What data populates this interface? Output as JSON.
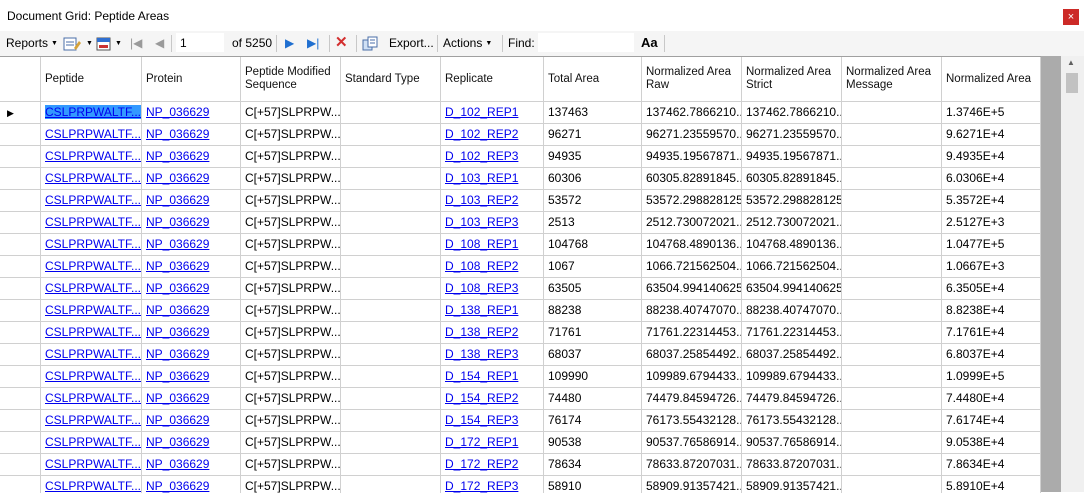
{
  "window": {
    "title": "Document Grid: Peptide Areas",
    "close_icon": "×"
  },
  "toolbar": {
    "reports_label": "Reports",
    "position_value": "1",
    "of_label": "of 5250",
    "export_label": "Export...",
    "actions_label": "Actions",
    "find_label": "Find:",
    "find_value": "",
    "font_icon": "Aa"
  },
  "grid": {
    "headers": [
      "Peptide",
      "Protein",
      "Peptide Modified Sequence",
      "Standard Type",
      "Replicate",
      "Total Area",
      "Normalized Area Raw",
      "Normalized Area Strict",
      "Normalized Area Message",
      "Normalized Area"
    ],
    "rows": [
      [
        "CSLPRPWALTF...",
        "NP_036629",
        "C[+57]SLPRPW...",
        "",
        "D_102_REP1",
        "137463",
        "137462.7866210...",
        "137462.7866210...",
        "",
        "1.3746E+5"
      ],
      [
        "CSLPRPWALTF...",
        "NP_036629",
        "C[+57]SLPRPW...",
        "",
        "D_102_REP2",
        "96271",
        "96271.23559570...",
        "96271.23559570...",
        "",
        "9.6271E+4"
      ],
      [
        "CSLPRPWALTF...",
        "NP_036629",
        "C[+57]SLPRPW...",
        "",
        "D_102_REP3",
        "94935",
        "94935.19567871...",
        "94935.19567871...",
        "",
        "9.4935E+4"
      ],
      [
        "CSLPRPWALTF...",
        "NP_036629",
        "C[+57]SLPRPW...",
        "",
        "D_103_REP1",
        "60306",
        "60305.82891845...",
        "60305.82891845...",
        "",
        "6.0306E+4"
      ],
      [
        "CSLPRPWALTF...",
        "NP_036629",
        "C[+57]SLPRPW...",
        "",
        "D_103_REP2",
        "53572",
        "53572.298828125",
        "53572.298828125",
        "",
        "5.3572E+4"
      ],
      [
        "CSLPRPWALTF...",
        "NP_036629",
        "C[+57]SLPRPW...",
        "",
        "D_103_REP3",
        "2513",
        "2512.730072021...",
        "2512.730072021...",
        "",
        "2.5127E+3"
      ],
      [
        "CSLPRPWALTF...",
        "NP_036629",
        "C[+57]SLPRPW...",
        "",
        "D_108_REP1",
        "104768",
        "104768.4890136...",
        "104768.4890136...",
        "",
        "1.0477E+5"
      ],
      [
        "CSLPRPWALTF...",
        "NP_036629",
        "C[+57]SLPRPW...",
        "",
        "D_108_REP2",
        "1067",
        "1066.721562504...",
        "1066.721562504...",
        "",
        "1.0667E+3"
      ],
      [
        "CSLPRPWALTF...",
        "NP_036629",
        "C[+57]SLPRPW...",
        "",
        "D_108_REP3",
        "63505",
        "63504.994140625",
        "63504.994140625",
        "",
        "6.3505E+4"
      ],
      [
        "CSLPRPWALTF...",
        "NP_036629",
        "C[+57]SLPRPW...",
        "",
        "D_138_REP1",
        "88238",
        "88238.40747070...",
        "88238.40747070...",
        "",
        "8.8238E+4"
      ],
      [
        "CSLPRPWALTF...",
        "NP_036629",
        "C[+57]SLPRPW...",
        "",
        "D_138_REP2",
        "71761",
        "71761.22314453...",
        "71761.22314453...",
        "",
        "7.1761E+4"
      ],
      [
        "CSLPRPWALTF...",
        "NP_036629",
        "C[+57]SLPRPW...",
        "",
        "D_138_REP3",
        "68037",
        "68037.25854492...",
        "68037.25854492...",
        "",
        "6.8037E+4"
      ],
      [
        "CSLPRPWALTF...",
        "NP_036629",
        "C[+57]SLPRPW...",
        "",
        "D_154_REP1",
        "109990",
        "109989.6794433...",
        "109989.6794433...",
        "",
        "1.0999E+5"
      ],
      [
        "CSLPRPWALTF...",
        "NP_036629",
        "C[+57]SLPRPW...",
        "",
        "D_154_REP2",
        "74480",
        "74479.84594726...",
        "74479.84594726...",
        "",
        "7.4480E+4"
      ],
      [
        "CSLPRPWALTF...",
        "NP_036629",
        "C[+57]SLPRPW...",
        "",
        "D_154_REP3",
        "76174",
        "76173.55432128...",
        "76173.55432128...",
        "",
        "7.6174E+4"
      ],
      [
        "CSLPRPWALTF...",
        "NP_036629",
        "C[+57]SLPRPW...",
        "",
        "D_172_REP1",
        "90538",
        "90537.76586914...",
        "90537.76586914...",
        "",
        "9.0538E+4"
      ],
      [
        "CSLPRPWALTF...",
        "NP_036629",
        "C[+57]SLPRPW...",
        "",
        "D_172_REP2",
        "78634",
        "78633.87207031...",
        "78633.87207031...",
        "",
        "7.8634E+4"
      ],
      [
        "CSLPRPWALTF...",
        "NP_036629",
        "C[+57]SLPRPW...",
        "",
        "D_172_REP3",
        "58910",
        "58909.91357421...",
        "58909.91357421...",
        "",
        "5.8910E+4"
      ]
    ]
  }
}
